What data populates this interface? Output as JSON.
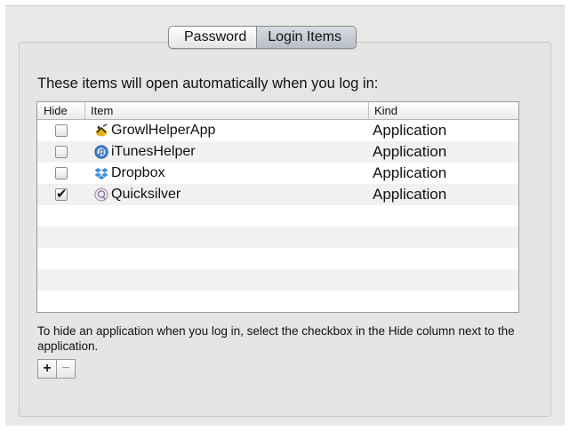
{
  "tabs": [
    {
      "label": "Password",
      "active": false
    },
    {
      "label": "Login Items",
      "active": true
    }
  ],
  "heading": "These items will open automatically when you log in:",
  "table": {
    "columns": {
      "hide": "Hide",
      "item": "Item",
      "kind": "Kind"
    },
    "rows": [
      {
        "name": "GrowlHelperApp",
        "kind": "Application",
        "hide_checked": false,
        "icon": "growl-icon"
      },
      {
        "name": "iTunesHelper",
        "kind": "Application",
        "hide_checked": false,
        "icon": "itunes-icon"
      },
      {
        "name": "Dropbox",
        "kind": "Application",
        "hide_checked": false,
        "icon": "dropbox-icon"
      },
      {
        "name": "Quicksilver",
        "kind": "Application",
        "hide_checked": true,
        "icon": "quicksilver-icon"
      }
    ]
  },
  "instructions": "To hide an application when you log in, select the checkbox in the Hide column next to the application.",
  "buttons": {
    "add_label": "+",
    "remove_label": "−"
  },
  "checkmark": "✔"
}
